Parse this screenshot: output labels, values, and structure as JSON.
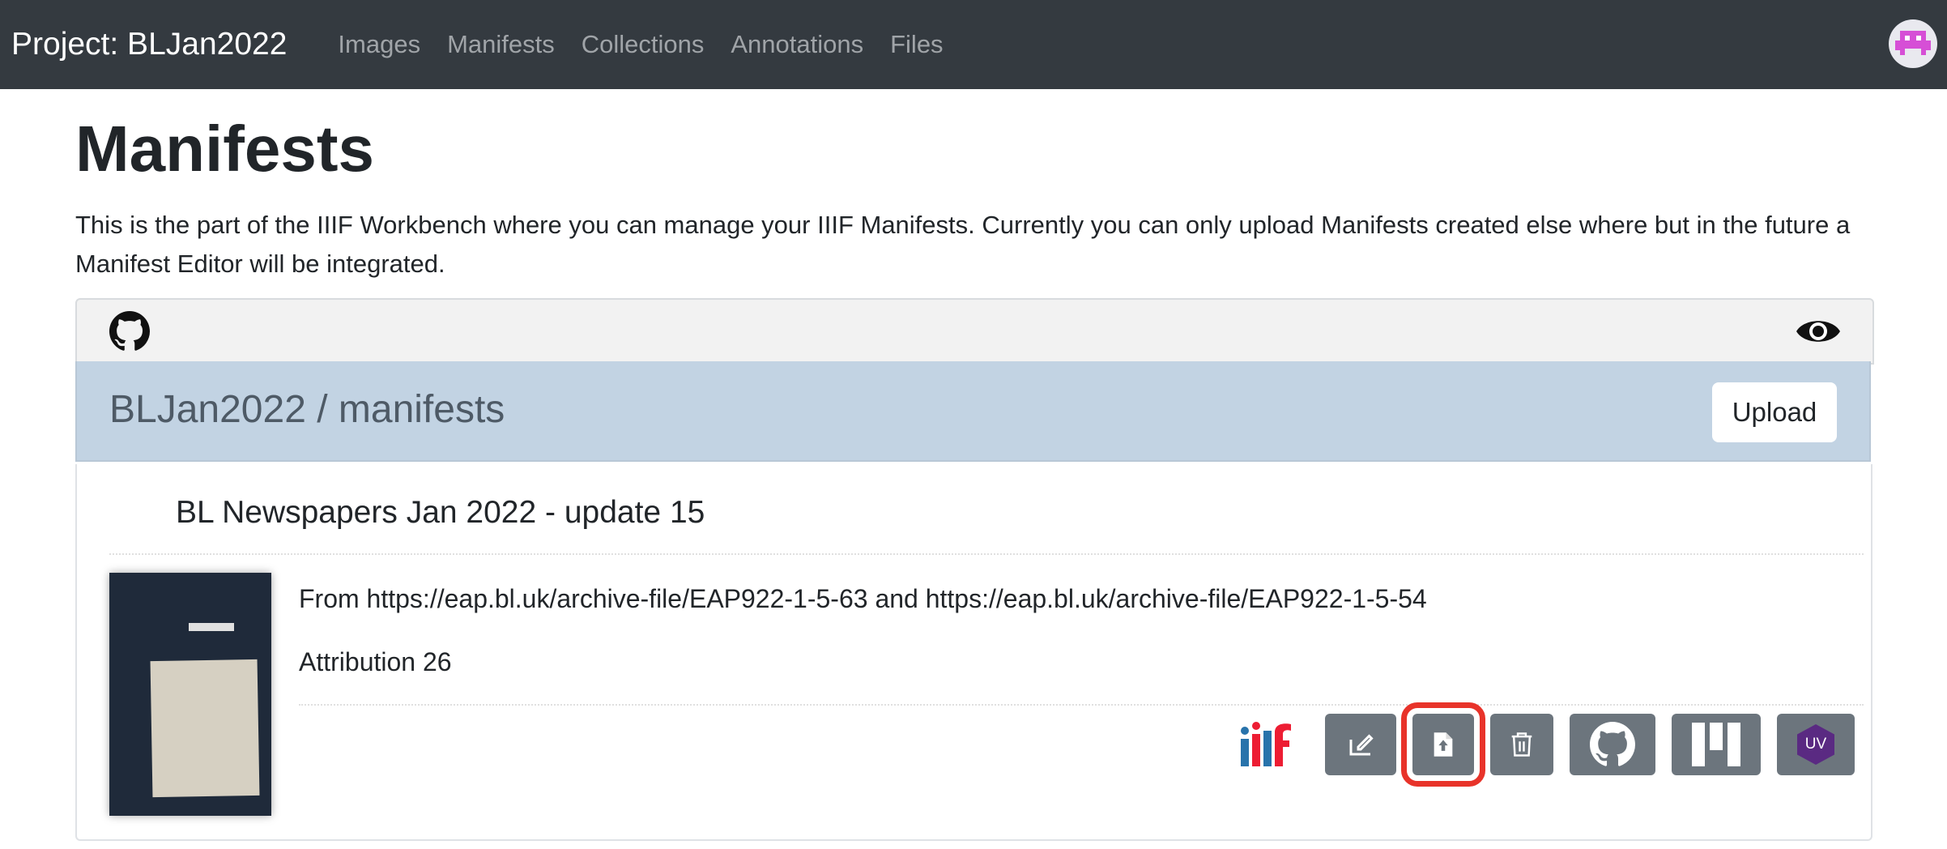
{
  "navbar": {
    "brand": "Project: BLJan2022",
    "links": [
      "Images",
      "Manifests",
      "Collections",
      "Annotations",
      "Files"
    ]
  },
  "page": {
    "title": "Manifests",
    "intro": "This is the part of the IIIF Workbench where you can manage your IIIF Manifests. Currently you can only upload Manifests created else where but in the future a Manifest Editor will be integrated."
  },
  "repo": {
    "path": "BLJan2022 / manifests",
    "upload_label": "Upload"
  },
  "manifest": {
    "title": "BL Newspapers Jan 2022 - update 15",
    "description": "From https://eap.bl.uk/archive-file/EAP922-1-5-63 and https://eap.bl.uk/archive-file/EAP922-1-5-54",
    "attribution": "Attribution 26",
    "actions": [
      "iiif-logo",
      "edit-icon",
      "file-upload-icon",
      "trash-icon",
      "github-icon",
      "mirador-icon",
      "uv-icon"
    ],
    "uv_label": "UV"
  },
  "colors": {
    "navbar": "#343a40",
    "repo_bar": "#c2d3e3",
    "action_button": "#6c757d",
    "highlight": "#e8332a",
    "uv": "#5a2a82"
  }
}
